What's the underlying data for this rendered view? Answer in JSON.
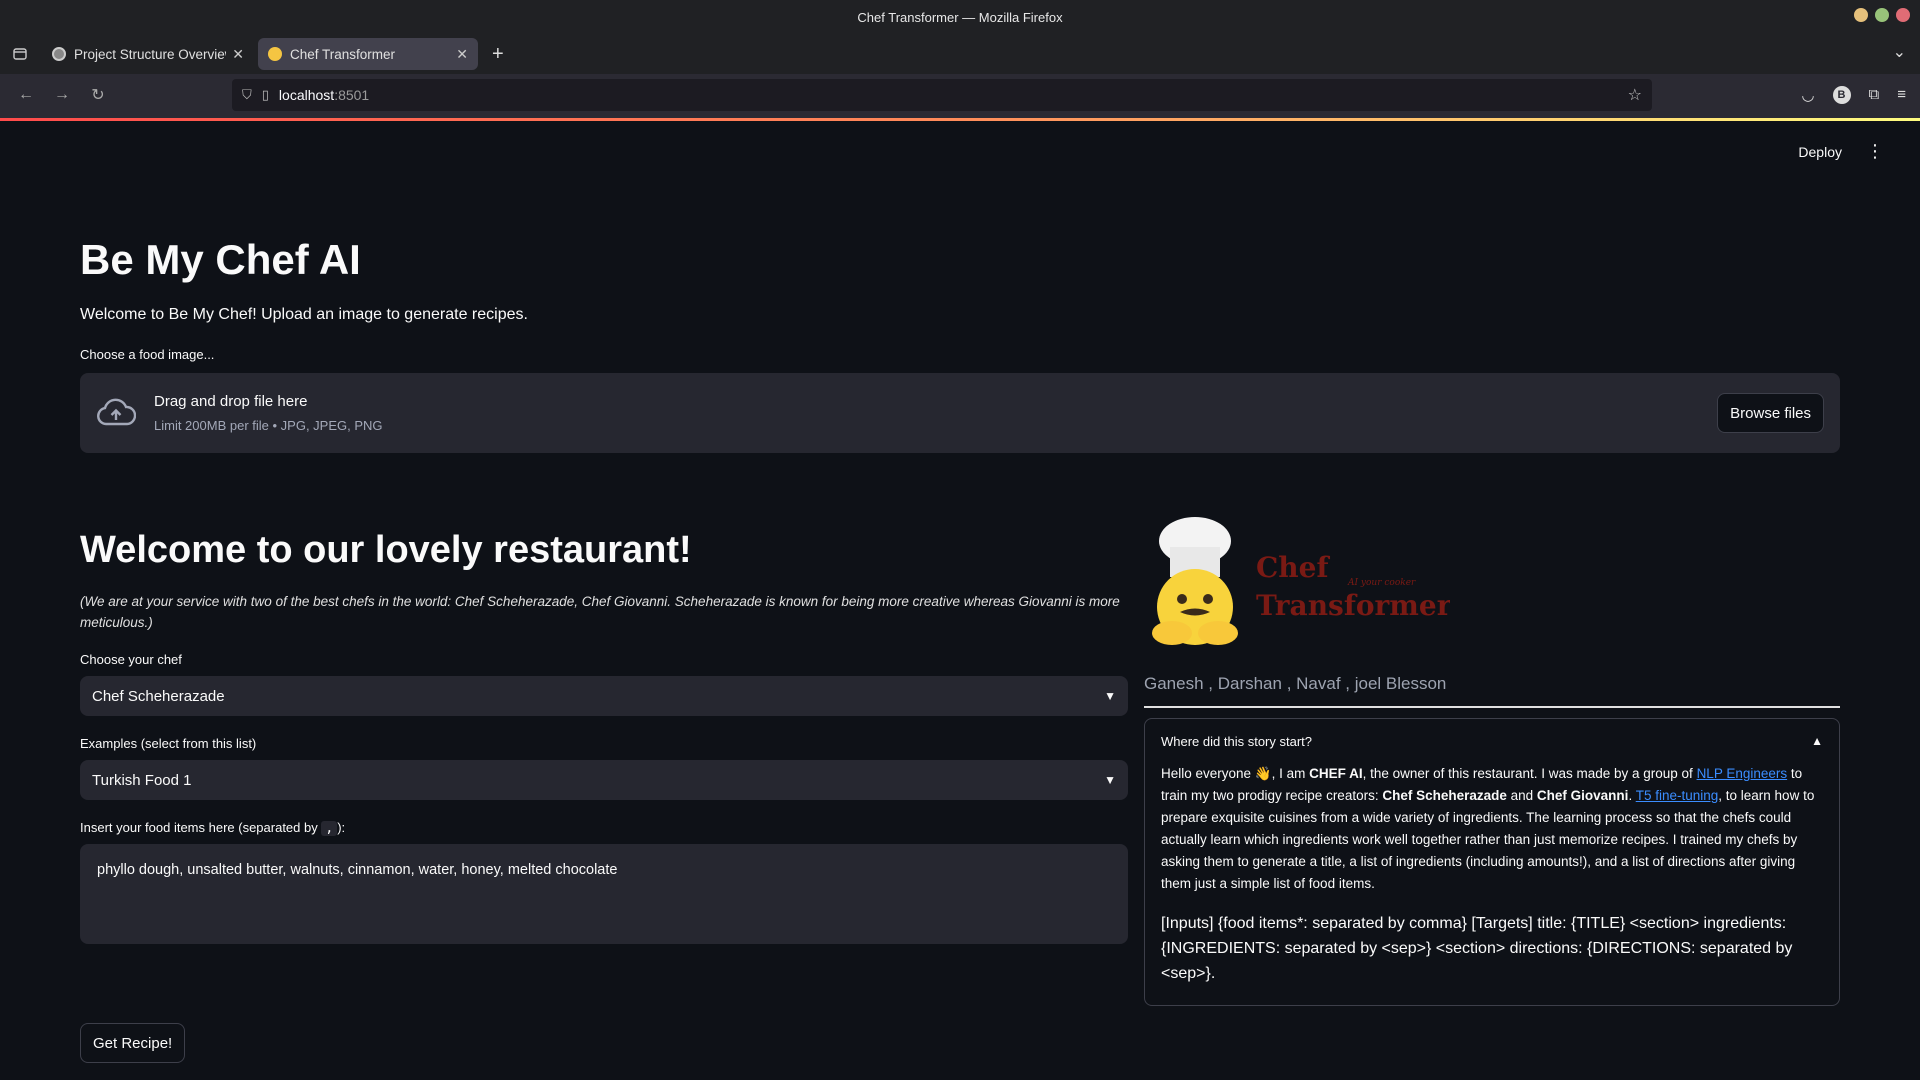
{
  "window": {
    "title": "Chef Transformer — Mozilla Firefox"
  },
  "tabs": [
    {
      "label": "Project Structure Overview",
      "active": false
    },
    {
      "label": "Chef Transformer",
      "active": true
    }
  ],
  "navbar": {
    "url_host": "localhost",
    "url_port": ":8501",
    "profile_initial": "B"
  },
  "app": {
    "deploy_label": "Deploy",
    "main_title": "Be My Chef AI",
    "intro": "Welcome to Be My Chef! Upload an image to generate recipes.",
    "uploader": {
      "label": "Choose a food image...",
      "drop_title": "Drag and drop file here",
      "drop_limit": "Limit 200MB per file • JPG, JPEG, PNG",
      "browse_label": "Browse files"
    },
    "welcome_heading": "Welcome to our lovely restaurant!",
    "service_note": "(We are at your service with two of the best chefs in the world: Chef Scheherazade, Chef Giovanni. Scheherazade is known for being more creative whereas Giovanni is more meticulous.)",
    "chef_select": {
      "label": "Choose your chef",
      "value": "Chef Scheherazade"
    },
    "examples_select": {
      "label": "Examples (select from this list)",
      "value": "Turkish Food 1"
    },
    "food_items": {
      "label_prefix": "Insert your food items here (separated by ",
      "label_sep": ",",
      "label_suffix": "):",
      "value": "phyllo dough, unsalted butter, walnuts, cinnamon, water, honey, melted chocolate"
    },
    "get_recipe_label": "Get Recipe!",
    "logo": {
      "line1": "Chef",
      "line2": "Transformer",
      "tagline": "AI your cooker"
    },
    "credits": "Ganesh , Darshan , Navaf , joel Blesson",
    "story": {
      "header": "Where did this story start?",
      "p1_a": "Hello everyone 👋, I am ",
      "p1_b": "CHEF AI",
      "p1_c": ", the owner of this restaurant. I was made by a group of ",
      "p1_link1": "NLP Engineers",
      "p1_d": " to train my two prodigy recipe creators: ",
      "p1_e": "Chef Scheherazade",
      "p1_f": " and ",
      "p1_g": "Chef Giovanni",
      "p1_h": ". ",
      "p1_link2": "T5 fine-tuning",
      "p1_i": ", to learn how to prepare exquisite cuisines from a wide variety of ingredients. The learning process so that the chefs could actually learn which ingredients work well together rather than just memorize recipes. I trained my chefs by asking them to generate a title, a list of ingredients (including amounts!), and a list of directions after giving them just a simple list of food items.",
      "schema": "[Inputs] {food items*: separated by comma} [Targets] title: {TITLE} <section> ingredients: {INGREDIENTS: separated by <sep>} <section> directions: {DIRECTIONS: separated by <sep>}."
    }
  },
  "colors": {
    "app_bg": "#0e1117",
    "widget_bg": "#262730",
    "link": "#3b8dff",
    "accent_red": "#ff4b4b"
  }
}
